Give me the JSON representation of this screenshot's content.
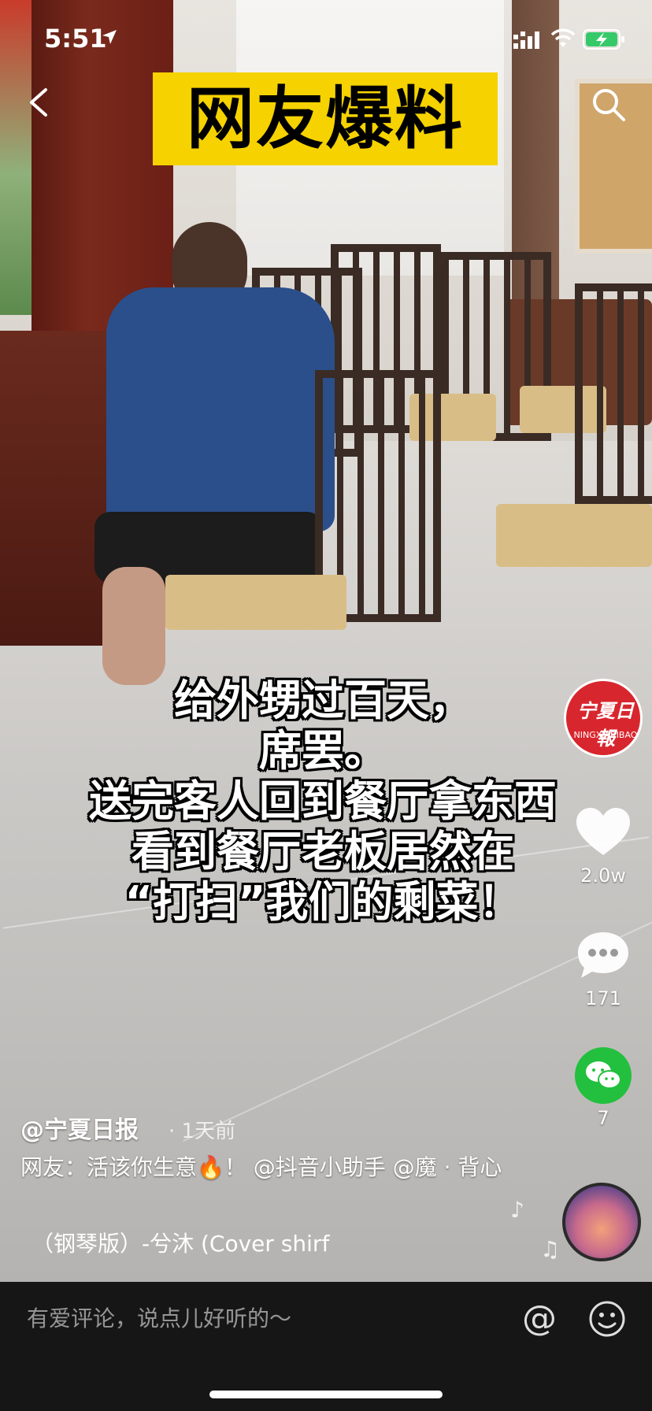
{
  "status_bar": {
    "time": "5:51",
    "icons": [
      "location-arrow-icon",
      "signal-icon",
      "wifi-icon",
      "battery-charging-icon"
    ]
  },
  "nav": {
    "back_icon": "chevron-left-icon",
    "search_icon": "search-icon"
  },
  "banner": {
    "text": "网友爆料"
  },
  "caption": {
    "lines": [
      "给外甥过百天，",
      "席罢。",
      "送完客人回到餐厅拿东西",
      "看到餐厅老板居然在",
      "“打扫”我们的剩菜！"
    ]
  },
  "creator": {
    "avatar_text": "宁夏日報",
    "avatar_subtext": "NINGXIARIBAO",
    "handle": "@宁夏日报",
    "time_ago": "· 1天前"
  },
  "actions": {
    "likes": "2.0w",
    "comments": "171",
    "shares": "7"
  },
  "description": "网友：活该你生意🔥！ @抖音小助手 @魔 · 背心",
  "music": "（钢琴版）-兮沐 (Cover shirf",
  "comment_bar": {
    "placeholder": "有爱评论，说点儿好听的～",
    "at_label": "@"
  },
  "colors": {
    "banner_bg": "#f5d200",
    "avatar_red": "#d8262e",
    "wechat_green": "#22c03e",
    "bottom_bar": "#161616"
  }
}
